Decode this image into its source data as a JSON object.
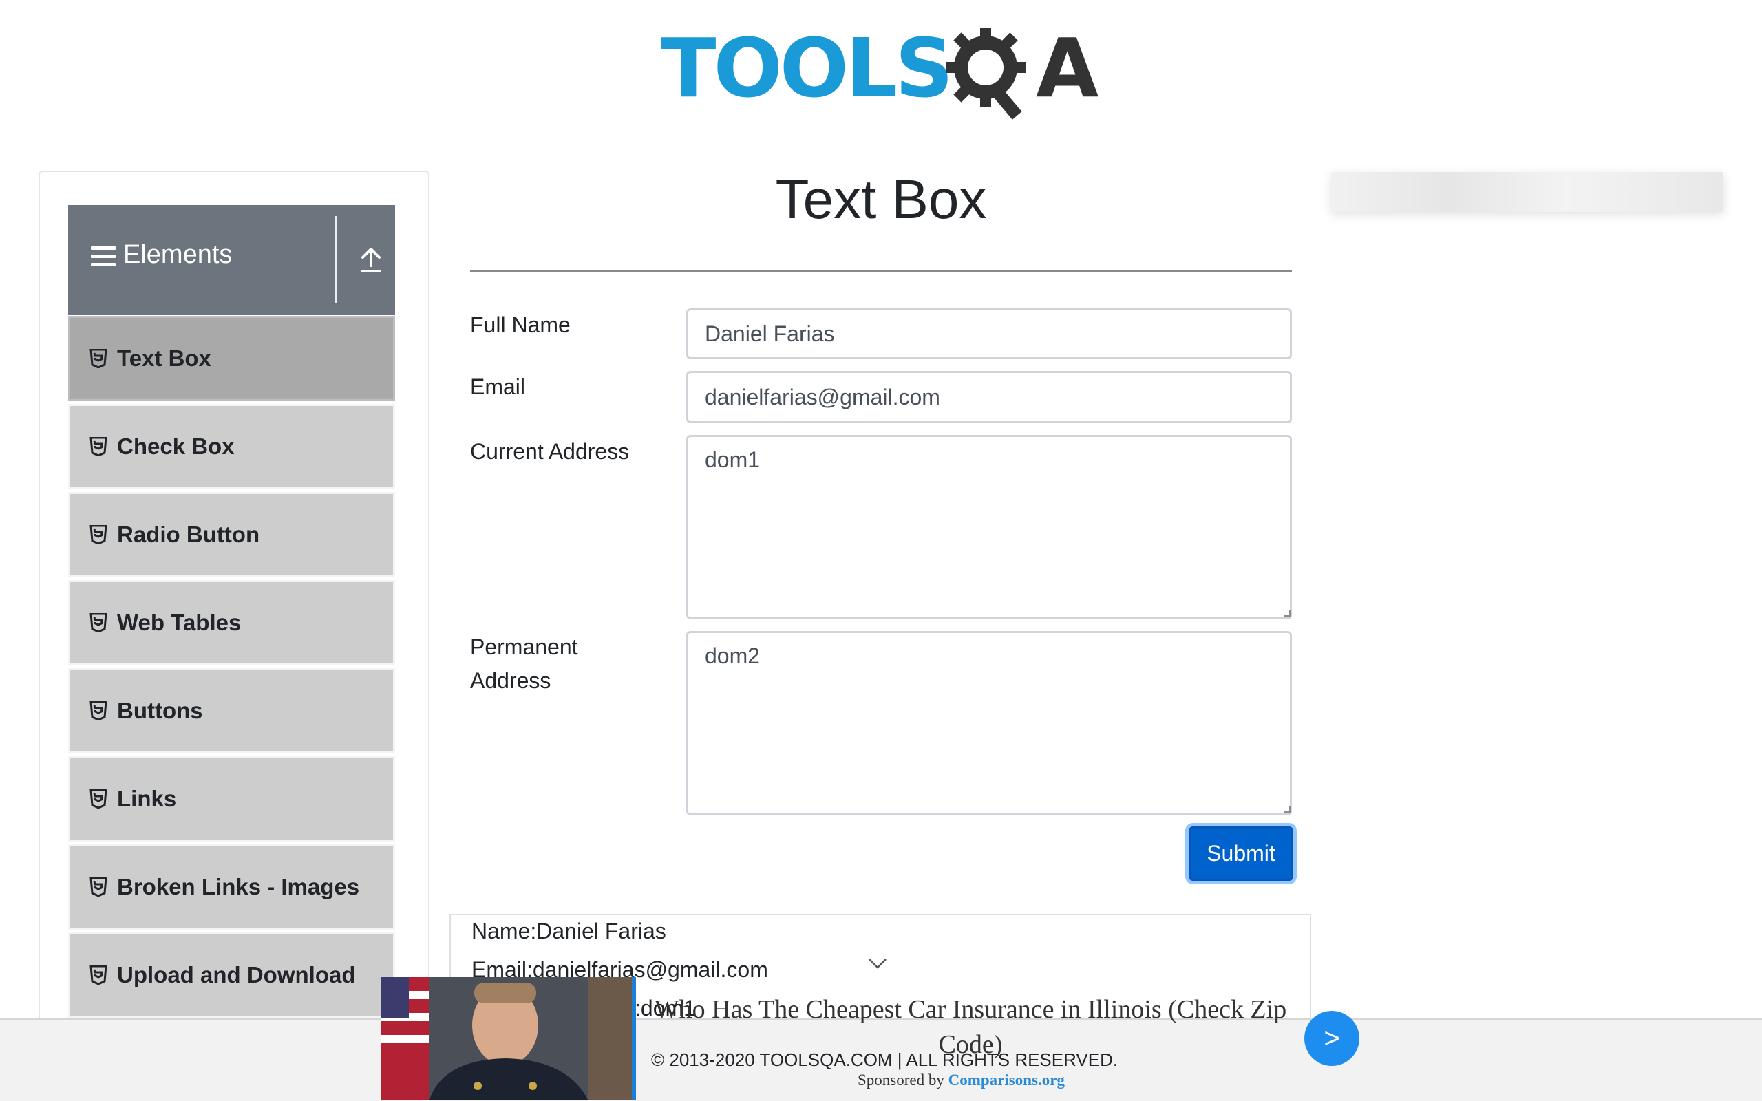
{
  "logo": {
    "part1": "TOOLS",
    "part2": "A"
  },
  "sidebar": {
    "group_title": "Elements",
    "items": [
      {
        "label": "Text Box",
        "active": true
      },
      {
        "label": "Check Box"
      },
      {
        "label": "Radio Button"
      },
      {
        "label": "Web Tables"
      },
      {
        "label": "Buttons"
      },
      {
        "label": "Links"
      },
      {
        "label": "Broken Links - Images"
      },
      {
        "label": "Upload and Download"
      }
    ]
  },
  "main": {
    "title": "Text Box",
    "form": {
      "full_name_label": "Full Name",
      "full_name_value": "Daniel Farias",
      "email_label": "Email",
      "email_value": "danielfarias@gmail.com",
      "current_address_label": "Current Address",
      "current_address_value": "dom1",
      "permanent_address_label_line1": "Permanent",
      "permanent_address_label_line2": "Address",
      "permanent_address_value": "dom2",
      "submit_label": "Submit"
    },
    "output": {
      "name": "Name:Daniel Farias",
      "email": "Email:danielfarias@gmail.com",
      "current_address_fragment": ":dom1"
    }
  },
  "footer": {
    "copyright": "© 2013-2020 TOOLSQA.COM | ALL RIGHTS RESERVED."
  },
  "ad_banner": {
    "headline": "Who Has The Cheapest Car Insurance in Illinois (Check Zip Code)",
    "sponsored_by": "Sponsored by",
    "sponsor": "Comparisons.org",
    "next_label": ">"
  },
  "colors": {
    "brand_blue": "#1a9ad6",
    "header_gray": "#6c757d",
    "menu_item": "#cdcdcd",
    "menu_item_active": "#a9a9a9",
    "primary_button": "#0062cc"
  }
}
